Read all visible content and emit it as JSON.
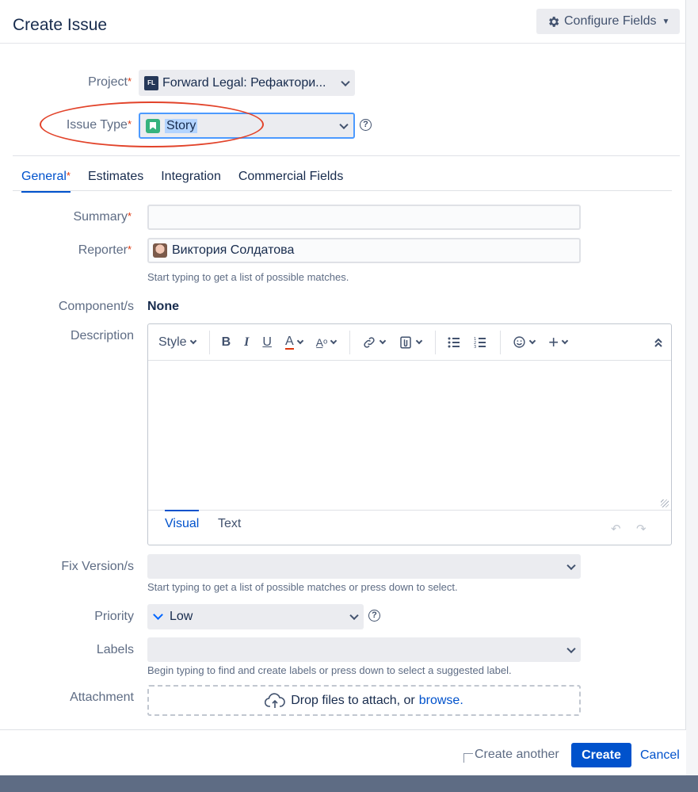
{
  "dialog": {
    "title": "Create Issue",
    "configure_fields_label": "Configure Fields"
  },
  "fields": {
    "project": {
      "label": "Project",
      "value": "Forward Legal: Рефактори..."
    },
    "issue_type": {
      "label": "Issue Type",
      "value": "Story"
    }
  },
  "tabs": [
    {
      "label": "General",
      "required": "*",
      "active": true
    },
    {
      "label": "Estimates"
    },
    {
      "label": "Integration"
    },
    {
      "label": "Commercial Fields"
    }
  ],
  "general": {
    "summary": {
      "label": "Summary",
      "value": ""
    },
    "reporter": {
      "label": "Reporter",
      "value": "Виктория Солдатова",
      "hint": "Start typing to get a list of possible matches."
    },
    "components": {
      "label": "Component/s",
      "value": "None"
    },
    "description": {
      "label": "Description",
      "toolbar": {
        "style_label": "Style"
      },
      "tabs": {
        "visual": "Visual",
        "text": "Text"
      }
    },
    "fix_version": {
      "label": "Fix Version/s",
      "value": "",
      "hint": "Start typing to get a list of possible matches or press down to select."
    },
    "priority": {
      "label": "Priority",
      "value": "Low"
    },
    "labels": {
      "label": "Labels",
      "value": "",
      "hint": "Begin typing to find and create labels or press down to select a suggested label."
    },
    "attachment": {
      "label": "Attachment",
      "drop_text": "Drop files to attach, or",
      "browse_link": "browse."
    }
  },
  "footer": {
    "create_another_label": "Create another",
    "create_label": "Create",
    "cancel_label": "Cancel"
  },
  "colors": {
    "primary": "#0052cc",
    "required": "#de350b",
    "annotation_ellipse": "#e2432a"
  }
}
